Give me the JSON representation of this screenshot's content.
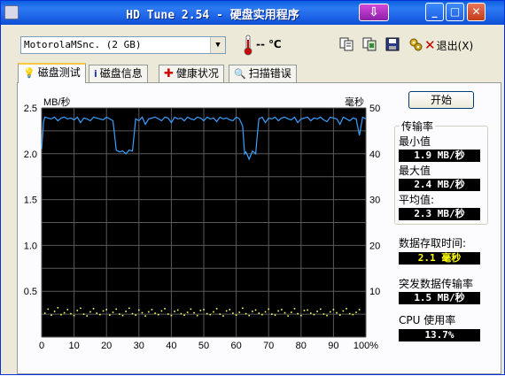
{
  "window": {
    "title": "HD Tune 2.54 - 硬盘实用程序",
    "download_glyph": "⇩",
    "min_glyph": "_",
    "max_glyph": "□",
    "close_glyph": "✕"
  },
  "toolbar": {
    "drive": "MotorolaMSnc.  (2 GB)",
    "temperature": "-- ℃",
    "exit_label": "退出(X)",
    "exit_glyph": "✕"
  },
  "tabs": [
    {
      "label": "磁盘测试",
      "active": true,
      "icon": "lightbulb-icon"
    },
    {
      "label": "磁盘信息",
      "active": false,
      "icon": "info-icon"
    },
    {
      "label": "健康状况",
      "active": false,
      "icon": "health-cross-icon"
    },
    {
      "label": "扫描错误",
      "active": false,
      "icon": "magnifier-icon"
    }
  ],
  "controls": {
    "start_label": "开始"
  },
  "stats": {
    "transfer_rate_title": "传输率",
    "min_label": "最小值",
    "min_value": "1.9 MB/秒",
    "max_label": "最大值",
    "max_value": "2.4 MB/秒",
    "avg_label": "平均值:",
    "avg_value": "2.3 MB/秒",
    "access_time_label": "数据存取时间:",
    "access_time_value": "2.1 毫秒",
    "burst_label": "突发数据传输率",
    "burst_value": "1.5 MB/秒",
    "cpu_label": "CPU 使用率",
    "cpu_value": "13.7%"
  },
  "colors": {
    "chart_bg": "#000000",
    "grid": "#5a5a5a",
    "transfer_line": "#3aa0ff",
    "access_points": "#ffff66"
  },
  "chart_data": {
    "type": "line",
    "left_axis_label": "MB/秒",
    "right_axis_label": "毫秒",
    "y_ticks": [
      "2.5",
      "2.0",
      "1.5",
      "1.0",
      "0.5"
    ],
    "y2_ticks": [
      "50",
      "40",
      "30",
      "20",
      "10"
    ],
    "x_ticks": [
      "0",
      "10",
      "20",
      "30",
      "40",
      "50",
      "60",
      "70",
      "80",
      "90",
      "100%"
    ],
    "ylim": [
      0,
      2.5
    ],
    "y2lim": [
      0,
      50
    ],
    "xlim": [
      0,
      100
    ],
    "grid": true,
    "series": [
      {
        "x": [
          0,
          0.6,
          1,
          2,
          3,
          4,
          5,
          6,
          7,
          8,
          9,
          10,
          11,
          12,
          13,
          14,
          15,
          16,
          17,
          18,
          19,
          20,
          21,
          22,
          22.5,
          23,
          24,
          25,
          26,
          27,
          28,
          28.5,
          29,
          30,
          31,
          32,
          33,
          34,
          35,
          36,
          37,
          38,
          39,
          40,
          41,
          42,
          43,
          44,
          45,
          46,
          47,
          48,
          49,
          50,
          51,
          52,
          53,
          54,
          55,
          56,
          57,
          58,
          59,
          60,
          61,
          62,
          62.6,
          63,
          64,
          65,
          66,
          66.5,
          67,
          68,
          69,
          70,
          71,
          72,
          73,
          74,
          75,
          76,
          77,
          78,
          79,
          80,
          81,
          82,
          83,
          84,
          85,
          86,
          87,
          88,
          89,
          90,
          91,
          92,
          93,
          94,
          95,
          96,
          97,
          98,
          99,
          100
        ],
        "y": [
          2.05,
          2.35,
          2.4,
          2.39,
          2.38,
          2.4,
          2.36,
          2.39,
          2.4,
          2.38,
          2.39,
          2.37,
          2.4,
          2.34,
          2.39,
          2.38,
          2.36,
          2.4,
          2.39,
          2.38,
          2.37,
          2.4,
          2.38,
          2.36,
          2.2,
          2.04,
          2.02,
          2.03,
          2.0,
          2.04,
          2.03,
          2.2,
          2.38,
          2.36,
          2.4,
          2.32,
          2.38,
          2.39,
          2.4,
          2.38,
          2.36,
          2.4,
          2.39,
          2.34,
          2.4,
          2.38,
          2.39,
          2.36,
          2.4,
          2.38,
          2.37,
          2.4,
          2.39,
          2.36,
          2.4,
          2.38,
          2.39,
          2.35,
          2.4,
          2.38,
          2.39,
          2.37,
          2.36,
          2.4,
          2.38,
          2.3,
          2.0,
          2.02,
          1.94,
          2.03,
          2.0,
          2.2,
          2.38,
          2.4,
          2.34,
          2.39,
          2.38,
          2.4,
          2.36,
          2.39,
          2.4,
          2.38,
          2.37,
          2.4,
          2.34,
          2.38,
          2.39,
          2.4,
          2.36,
          2.39,
          2.38,
          2.4,
          2.37,
          2.35,
          2.4,
          2.39,
          2.38,
          2.32,
          2.4,
          2.38,
          2.36,
          2.39,
          2.38,
          2.2,
          2.4,
          2.38
        ]
      }
    ],
    "access_points_y2": [
      [
        1,
        5.2
      ],
      [
        2,
        6.1
      ],
      [
        3,
        4.8
      ],
      [
        4,
        5.6
      ],
      [
        5,
        6.4
      ],
      [
        6,
        4.9
      ],
      [
        7,
        5.3
      ],
      [
        8,
        6.0
      ],
      [
        9,
        5.1
      ],
      [
        10,
        4.7
      ],
      [
        11,
        5.8
      ],
      [
        12,
        6.3
      ],
      [
        13,
        5.0
      ],
      [
        14,
        4.6
      ],
      [
        15,
        5.5
      ],
      [
        16,
        6.2
      ],
      [
        17,
        5.2
      ],
      [
        18,
        4.9
      ],
      [
        19,
        5.7
      ],
      [
        20,
        6.0
      ],
      [
        21,
        4.8
      ],
      [
        22,
        5.4
      ],
      [
        23,
        6.1
      ],
      [
        24,
        5.0
      ],
      [
        25,
        4.7
      ],
      [
        26,
        5.6
      ],
      [
        27,
        6.3
      ],
      [
        28,
        5.1
      ],
      [
        29,
        4.8
      ],
      [
        30,
        5.9
      ],
      [
        31,
        5.3
      ],
      [
        32,
        4.6
      ],
      [
        33,
        5.5
      ],
      [
        34,
        6.0
      ],
      [
        35,
        5.2
      ],
      [
        36,
        4.9
      ],
      [
        37,
        5.7
      ],
      [
        38,
        6.2
      ],
      [
        39,
        5.0
      ],
      [
        40,
        4.7
      ],
      [
        41,
        5.6
      ],
      [
        42,
        5.9
      ],
      [
        43,
        5.1
      ],
      [
        44,
        4.8
      ],
      [
        45,
        5.4
      ],
      [
        46,
        6.1
      ],
      [
        47,
        5.3
      ],
      [
        48,
        4.7
      ],
      [
        49,
        5.8
      ],
      [
        50,
        6.0
      ],
      [
        51,
        5.1
      ],
      [
        52,
        4.9
      ],
      [
        53,
        5.5
      ],
      [
        54,
        6.2
      ],
      [
        55,
        5.0
      ],
      [
        56,
        4.6
      ],
      [
        57,
        5.7
      ],
      [
        58,
        6.0
      ],
      [
        59,
        5.2
      ],
      [
        60,
        4.8
      ],
      [
        61,
        5.4
      ],
      [
        62,
        6.3
      ],
      [
        63,
        5.1
      ],
      [
        64,
        4.7
      ],
      [
        65,
        5.6
      ],
      [
        66,
        5.9
      ],
      [
        67,
        5.2
      ],
      [
        68,
        4.9
      ],
      [
        69,
        5.5
      ],
      [
        70,
        6.1
      ],
      [
        71,
        5.0
      ],
      [
        72,
        4.8
      ],
      [
        73,
        5.7
      ],
      [
        74,
        6.0
      ],
      [
        75,
        5.3
      ],
      [
        76,
        4.6
      ],
      [
        77,
        5.4
      ],
      [
        78,
        6.2
      ],
      [
        79,
        5.1
      ],
      [
        80,
        4.7
      ],
      [
        81,
        5.8
      ],
      [
        82,
        5.9
      ],
      [
        83,
        5.2
      ],
      [
        84,
        4.9
      ],
      [
        85,
        5.6
      ],
      [
        86,
        6.1
      ],
      [
        87,
        5.0
      ],
      [
        88,
        4.7
      ],
      [
        89,
        5.5
      ],
      [
        90,
        6.0
      ],
      [
        91,
        5.3
      ],
      [
        92,
        4.8
      ],
      [
        93,
        5.7
      ],
      [
        94,
        6.2
      ],
      [
        95,
        5.1
      ],
      [
        96,
        4.9
      ],
      [
        97,
        5.4
      ],
      [
        98,
        6.0
      ]
    ]
  }
}
